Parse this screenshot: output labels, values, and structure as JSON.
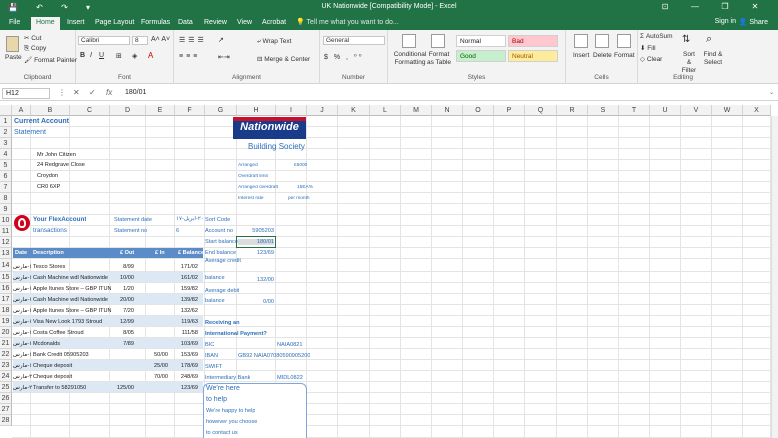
{
  "title_bar": {
    "title": "UK Nationwide  [Compatibility Mode] - Excel",
    "controls": [
      "⊡",
      "—",
      "❐",
      "✕"
    ]
  },
  "tabs": [
    "File",
    "Home",
    "Insert",
    "Page Layout",
    "Formulas",
    "Data",
    "Review",
    "View",
    "Acrobat"
  ],
  "tell_me": "Tell me what you want to do...",
  "sign_in": "Sign in",
  "share": "Share",
  "ribbon": {
    "clipboard": {
      "paste": "Paste",
      "cut": "Cut",
      "copy": "Copy",
      "format_painter": "Format Painter",
      "label": "Clipboard"
    },
    "font": {
      "name": "Calibri",
      "size": "8",
      "label": "Font"
    },
    "alignment": {
      "wrap_text": "Wrap Text",
      "merge_center": "Merge & Center",
      "label": "Alignment"
    },
    "number": {
      "format": "General",
      "label": "Number"
    },
    "styles": {
      "conditional_formatting": "Conditional Formatting",
      "format_as_table": "Format as Table",
      "normal": "Normal",
      "bad": "Bad",
      "good": "Good",
      "neutral": "Neutral",
      "label": "Styles"
    },
    "cells": {
      "insert": "Insert",
      "delete": "Delete",
      "format": "Format",
      "label": "Cells"
    },
    "editing": {
      "autosum": "AutoSum",
      "fill": "Fill",
      "clear": "Clear",
      "sort_filter": "Sort & Filter",
      "find_select": "Find & Select",
      "label": "Editing"
    }
  },
  "formula_bar": {
    "name_box": "H12",
    "value": "180/01"
  },
  "columns": [
    "A",
    "B",
    "C",
    "D",
    "E",
    "F",
    "G",
    "H",
    "I",
    "J",
    "K",
    "L",
    "M",
    "N",
    "O",
    "P",
    "Q",
    "R",
    "S",
    "T",
    "U",
    "V",
    "W",
    "X"
  ],
  "rows": [
    "1",
    "2",
    "3",
    "4",
    "5",
    "6",
    "7",
    "8",
    "9",
    "10",
    "11",
    "12",
    "13",
    "14",
    "15",
    "16",
    "17",
    "18",
    "19",
    "20",
    "21",
    "22",
    "23",
    "24",
    "25",
    "26",
    "27",
    "28"
  ],
  "sheet": {
    "title1": "Current Account",
    "title2": "Statement",
    "address": [
      "Mr John Citizen",
      "24 Redgrave Close",
      "Croydon",
      "CR0 6XP"
    ],
    "logo_name": "Nationwide",
    "logo_sub": "Building Society",
    "info_labels": [
      "Arranged",
      "Overdraft limit",
      "Arranged overdraft",
      "Interest rate"
    ],
    "info_values": [
      "£5000",
      "",
      "15EA%",
      "per month"
    ],
    "flex_title": "Your FlexAccount",
    "flex_sub": "transactions",
    "statement_date_label": "Statement date",
    "statement_date_value": "٢٠-أبريل-١٧",
    "statement_no_label": "Statement no",
    "statement_no_value": "6",
    "sort_code_label": "Sort Code",
    "account_no_label": "Account no",
    "account_no_value": "5905203",
    "start_balance_label": "Start balance",
    "start_balance_value": "180/01",
    "end_balance_label": "End balance",
    "end_balance_value": "123/69",
    "headers": [
      "Date",
      "Description",
      "£ Out",
      "£ In",
      "£ Balance"
    ],
    "transactions": [
      {
        "date": "١٠-مارس",
        "desc": "Tesco Stores",
        "out": "8/99",
        "in": "",
        "bal": "171/02"
      },
      {
        "date": "١١-مارس",
        "desc": "Cash Machine wdl Nationwide",
        "out": "10/00",
        "in": "",
        "bal": "161/02"
      },
      {
        "date": "١٢-مارس",
        "desc": "Apple Itunes Store – GBP ITUNES.CO",
        "out": "1/20",
        "in": "",
        "bal": "159/82"
      },
      {
        "date": "١٣-مارس",
        "desc": "Cash Machine wdl Nationwide",
        "out": "20/00",
        "in": "",
        "bal": "139/82"
      },
      {
        "date": "١٤-مارس",
        "desc": "Apple Itunes Store – GBP ITUNES.CO",
        "out": "7/20",
        "in": "",
        "bal": "132/62"
      },
      {
        "date": "١٥-مارس",
        "desc": "Visa New Look 1793 Stroud",
        "out": "12/99",
        "in": "",
        "bal": "119/63"
      },
      {
        "date": "١٦-مارس",
        "desc": "Costa Coffee Stroud",
        "out": "8/05",
        "in": "",
        "bal": "111/58"
      },
      {
        "date": "١٧-مارس",
        "desc": "Mcdonalds",
        "out": "7/89",
        "in": "",
        "bal": "103/69"
      },
      {
        "date": "١٨-مارس",
        "desc": "Bank Credit 05905203",
        "out": "",
        "in": "50/00",
        "bal": "153/69"
      },
      {
        "date": "١٩-مارس",
        "desc": "Cheque deposit",
        "out": "",
        "in": "25/00",
        "bal": "178/69"
      },
      {
        "date": "٢٠-مارس",
        "desc": "Cheque deposit",
        "out": "",
        "in": "70/00",
        "bal": "248/69"
      },
      {
        "date": "٢١-مارس",
        "desc": "Transfer to 58291050",
        "out": "125/00",
        "in": "",
        "bal": "123/69"
      }
    ],
    "avg_credit_label": "Average credit",
    "avg_credit_balance_label": "balance",
    "avg_credit_value": "132/00",
    "avg_debit_label": "Average debit",
    "avg_debit_balance_label": "balance",
    "avg_debit_value": "0/00",
    "receiving_label": "Receiving an",
    "intl_label": "International Payment?",
    "bic_label": "BIC",
    "bic_value": "NAIA0821",
    "iban_label": "IBAN",
    "iban_value": "GB92 NAIA07080590905200",
    "swift_label": "SWIFT",
    "intermediary_label": "Intermediary Bank",
    "intermediary_value": "MIDL0822",
    "help_lines": [
      "We're here",
      "to help",
      "We're happy to help",
      "however you choose",
      "to contact us"
    ]
  },
  "colors": {
    "excel_green": "#217346",
    "header_blue": "#5b8cc8",
    "link_blue": "#2d6fba",
    "nationwide_red": "#d0021b"
  }
}
